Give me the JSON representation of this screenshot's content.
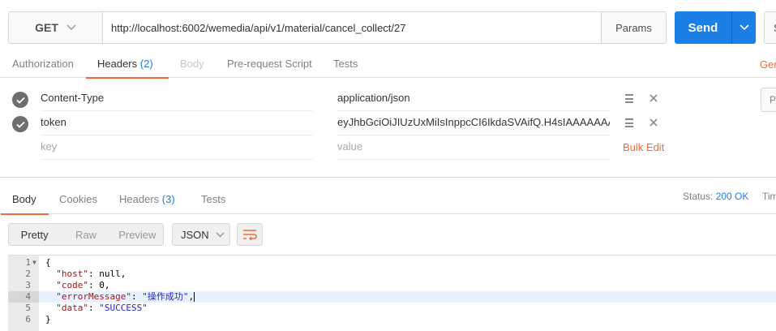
{
  "request": {
    "method": "GET",
    "url": "http://localhost:6002/wemedia/api/v1/material/cancel_collect/27",
    "params_label": "Params",
    "send_label": "Send",
    "save_label_partial": "S"
  },
  "request_tabs": [
    {
      "label": "Authorization"
    },
    {
      "label": "Headers",
      "count": "(2)"
    },
    {
      "label": "Body"
    },
    {
      "label": "Pre-request Script"
    },
    {
      "label": "Tests"
    }
  ],
  "generate_code_partial": "Gen",
  "headers": [
    {
      "key": "Content-Type",
      "value": "application/json",
      "enabled": true
    },
    {
      "key": "token",
      "value": "eyJhbGciOiJIUzUxMiIsInppcCI6IkdaSVAifQ.H4sIAAAAAAAAA",
      "enabled": true
    }
  ],
  "new_header": {
    "key_placeholder": "key",
    "value_placeholder": "value"
  },
  "bulk_edit_label": "Bulk Edit",
  "presets_partial": "Pr",
  "response_tabs": [
    {
      "label": "Body"
    },
    {
      "label": "Cookies"
    },
    {
      "label": "Headers",
      "count": "(3)"
    },
    {
      "label": "Tests"
    }
  ],
  "status": {
    "label": "Status:",
    "value": "200 OK",
    "time_partial": "Tim"
  },
  "view_modes": [
    "Pretty",
    "Raw",
    "Preview"
  ],
  "format": "JSON",
  "response_json": {
    "lines": [
      {
        "num": "1",
        "text": "{"
      },
      {
        "num": "2",
        "key": "\"host\"",
        "val": "null,"
      },
      {
        "num": "3",
        "key": "\"code\"",
        "val": "0,"
      },
      {
        "num": "4",
        "key": "\"errorMessage\"",
        "str": "\"操作成功\"",
        "tail": ","
      },
      {
        "num": "5",
        "key": "\"data\"",
        "str": "\"SUCCESS\"",
        "tail": ""
      },
      {
        "num": "6",
        "text": "}"
      }
    ]
  },
  "colors": {
    "accent": "#f26b3a",
    "primary": "#1a7fe7"
  }
}
